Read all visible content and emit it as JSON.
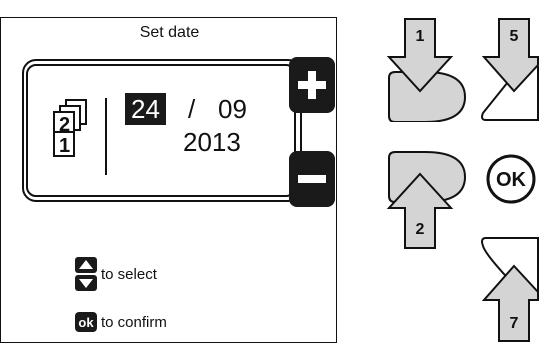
{
  "screen": {
    "title": "Set date",
    "date": {
      "day": "24",
      "separator": "/",
      "month": "09",
      "year": "2013"
    },
    "hints": {
      "select": "to select",
      "confirm": "to confirm"
    },
    "buttons": {
      "plus": "+",
      "minus": "−"
    }
  },
  "keypad": {
    "key_1": "1",
    "key_5": "5",
    "key_2": "2",
    "key_7": "7",
    "ok_label": "OK"
  },
  "colors": {
    "dark": "#1a1a1a",
    "key_fill": "#d4d4d4"
  }
}
